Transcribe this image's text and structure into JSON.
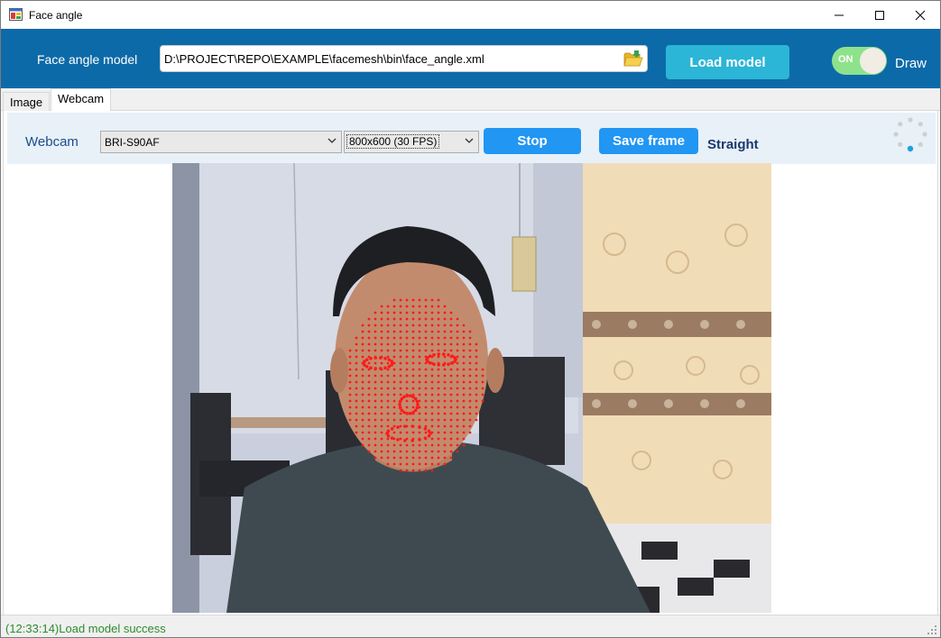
{
  "window": {
    "title": "Face angle",
    "controls": {
      "minimize": "—",
      "maximize": "☐",
      "close": "✕"
    }
  },
  "model_bar": {
    "label": "Face angle model",
    "path_value": "D:\\PROJECT\\REPO\\EXAMPLE\\facemesh\\bin\\face_angle.xml",
    "browse_icon": "folder-open-icon",
    "load_button": "Load model",
    "toggle": {
      "state_label": "ON",
      "on": true
    },
    "draw_label": "Draw"
  },
  "tabs": [
    {
      "label": "Image",
      "active": false
    },
    {
      "label": "Webcam",
      "active": true
    }
  ],
  "webcam": {
    "label": "Webcam",
    "camera_select": {
      "selected": "BRI-S90AF"
    },
    "resolution_select": {
      "selected": "800x600 (30 FPS)"
    },
    "stop_button": "Stop",
    "save_button": "Save frame",
    "pose_status": "Straight",
    "spinner_icon": "loading-spinner-icon"
  },
  "status_bar": {
    "message": "(12:33:14)Load model success"
  },
  "colors": {
    "header_blue": "#0d6aa8",
    "load_button": "#2bb5d6",
    "action_button": "#2196f3",
    "toggle_on": "#8fe28c",
    "landmark": "#ff1a1a",
    "status_success": "#2e8b2e"
  }
}
